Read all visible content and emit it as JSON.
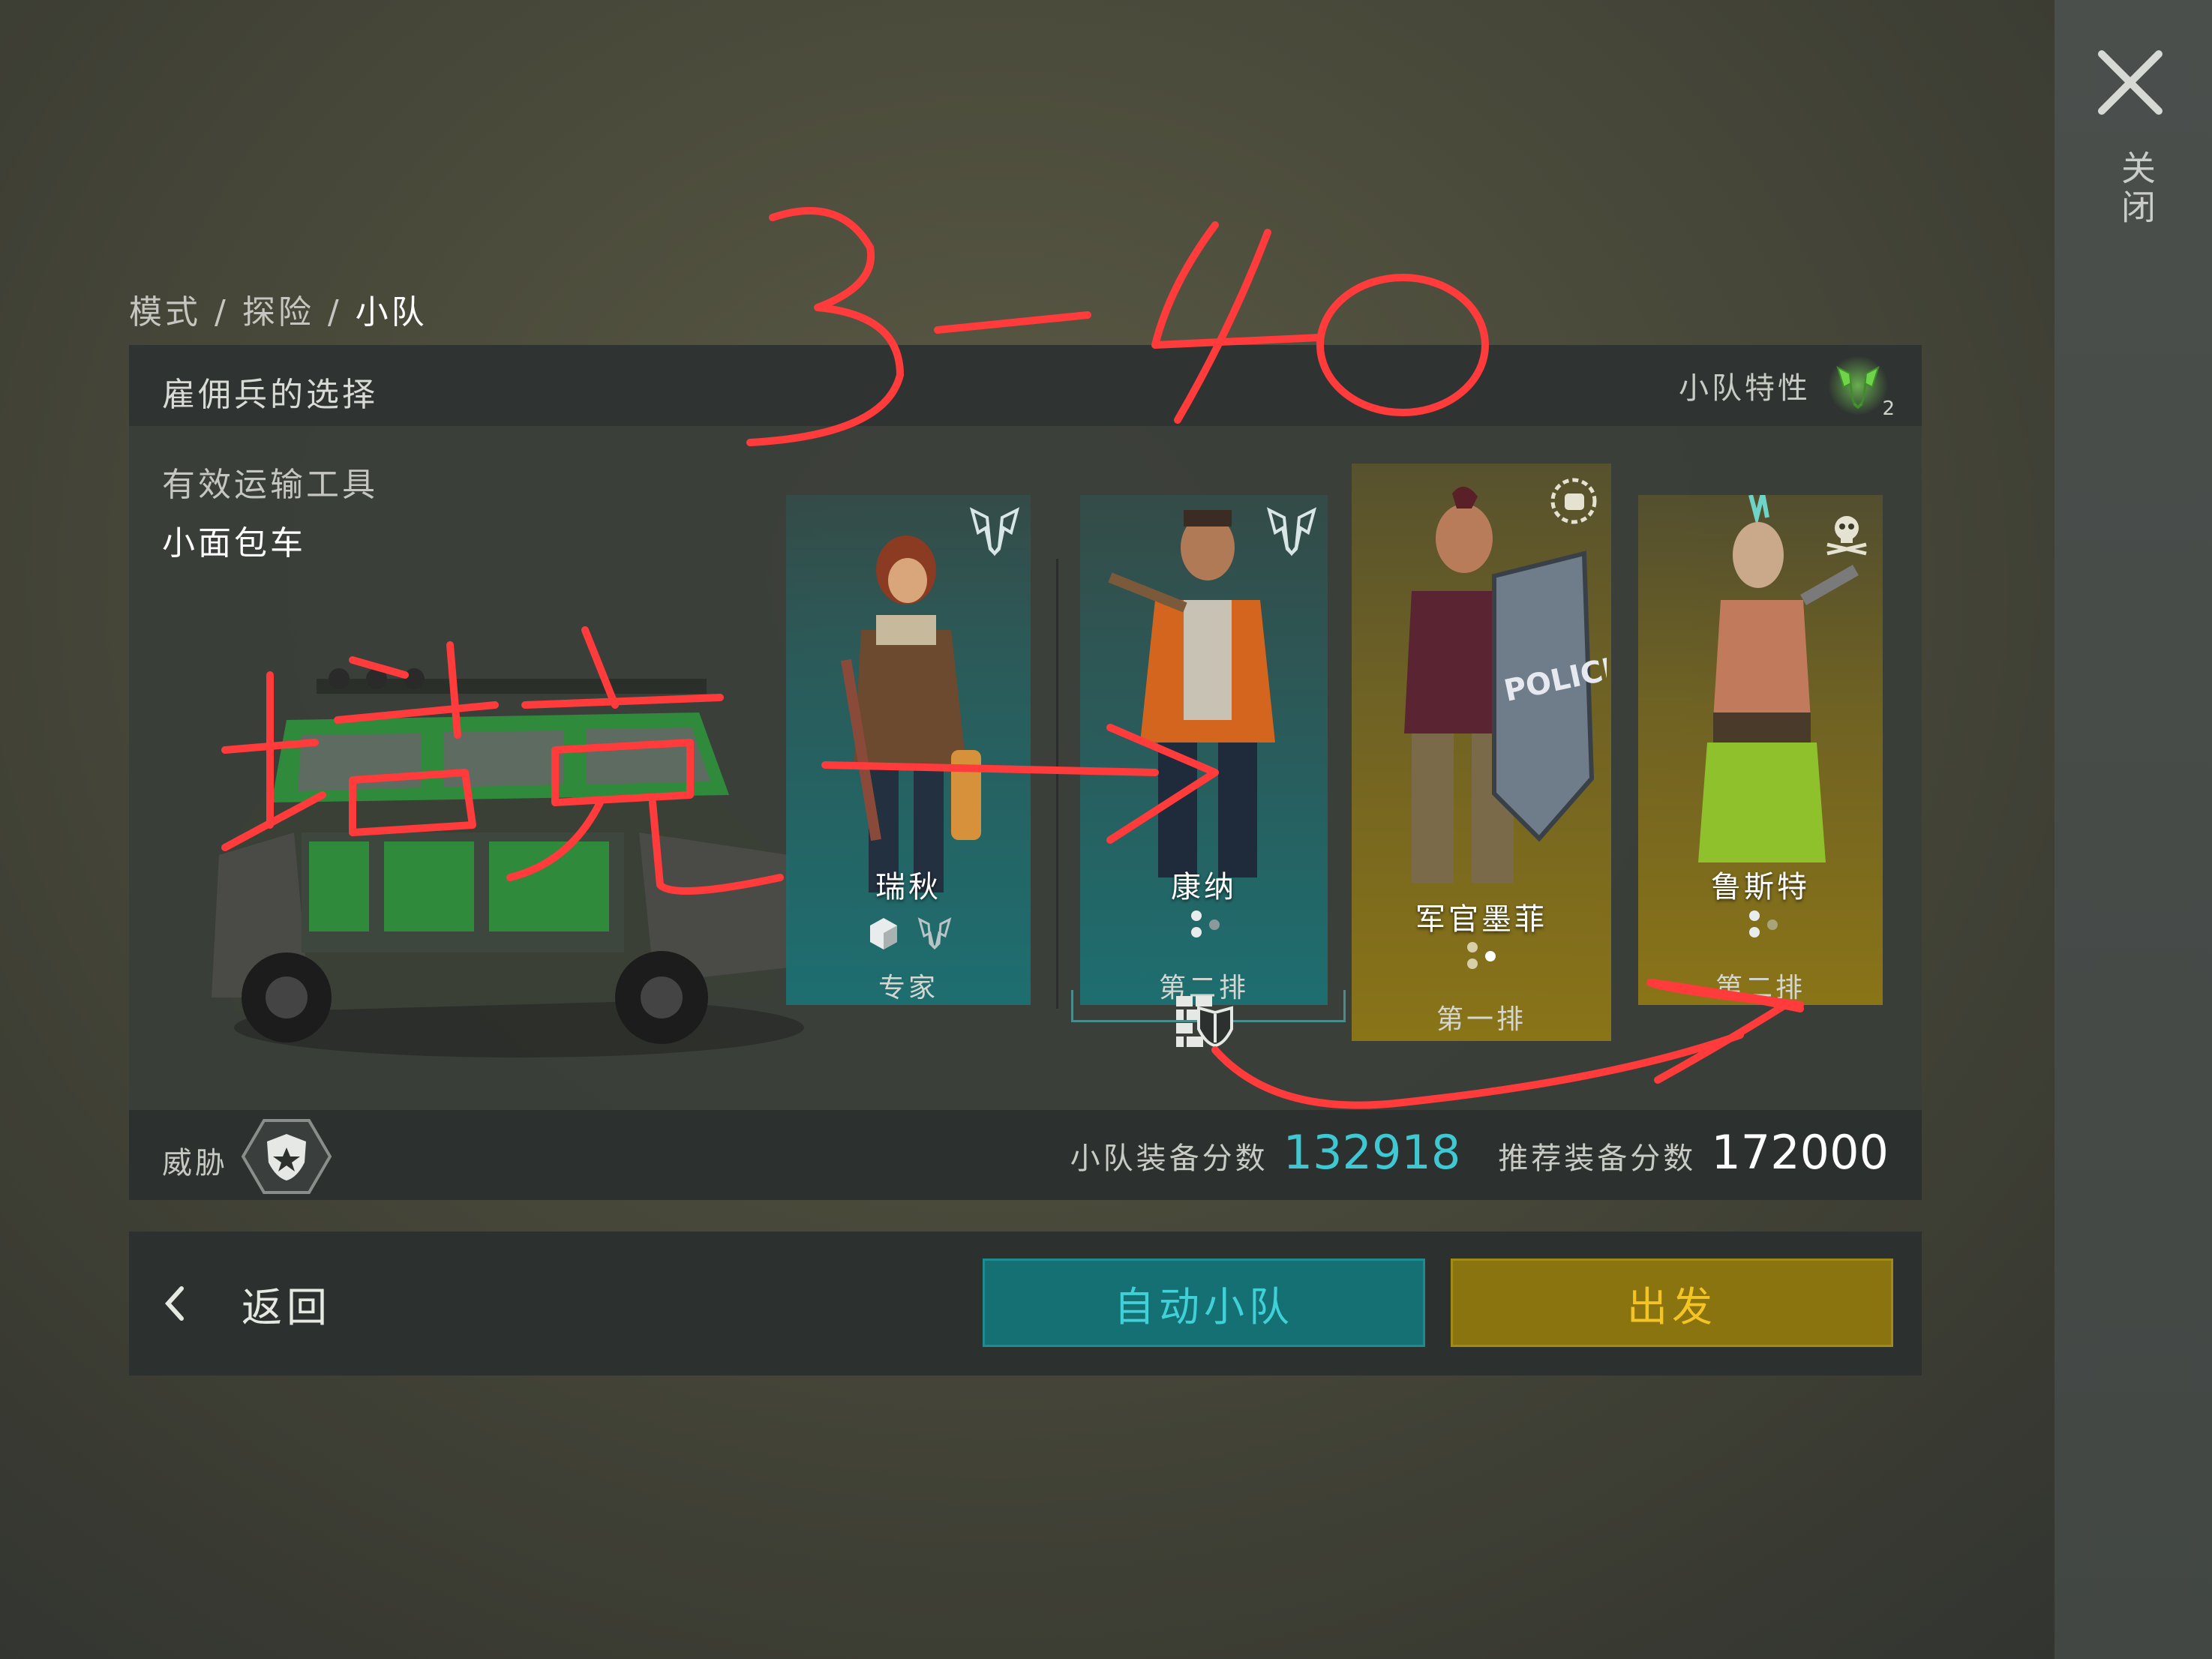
{
  "close": {
    "label": "关闭"
  },
  "breadcrumb": {
    "items": [
      "模式",
      "探险",
      "小队"
    ],
    "separator": "/"
  },
  "panel": {
    "title": "雇佣兵的选择",
    "trait_label": "小队特性",
    "trait_count": "2",
    "vehicle_label": "有效运输工具",
    "vehicle_name": "小面包车"
  },
  "cards": [
    {
      "name": "瑞秋",
      "row": "专家",
      "theme": "teal"
    },
    {
      "name": "康纳",
      "row": "第二排",
      "theme": "teal"
    },
    {
      "name": "军官墨菲",
      "row": "第一排",
      "theme": "gold"
    },
    {
      "name": "鲁斯特",
      "row": "第二排",
      "theme": "gold"
    }
  ],
  "footer": {
    "threat_label": "威胁",
    "squad_score_label": "小队装备分数",
    "squad_score": "132918",
    "recommended_score_label": "推荐装备分数",
    "recommended_score": "172000"
  },
  "actions": {
    "back": "返回",
    "auto": "自动小队",
    "go": "出发"
  },
  "annotations": {
    "level_text": "3-40",
    "tank_text": "塔克"
  },
  "colors": {
    "teal_card": "#1e6e70",
    "gold_card": "#8a7418",
    "score_accent": "#3fc8d2",
    "annotation_red": "#ff3b3b"
  }
}
